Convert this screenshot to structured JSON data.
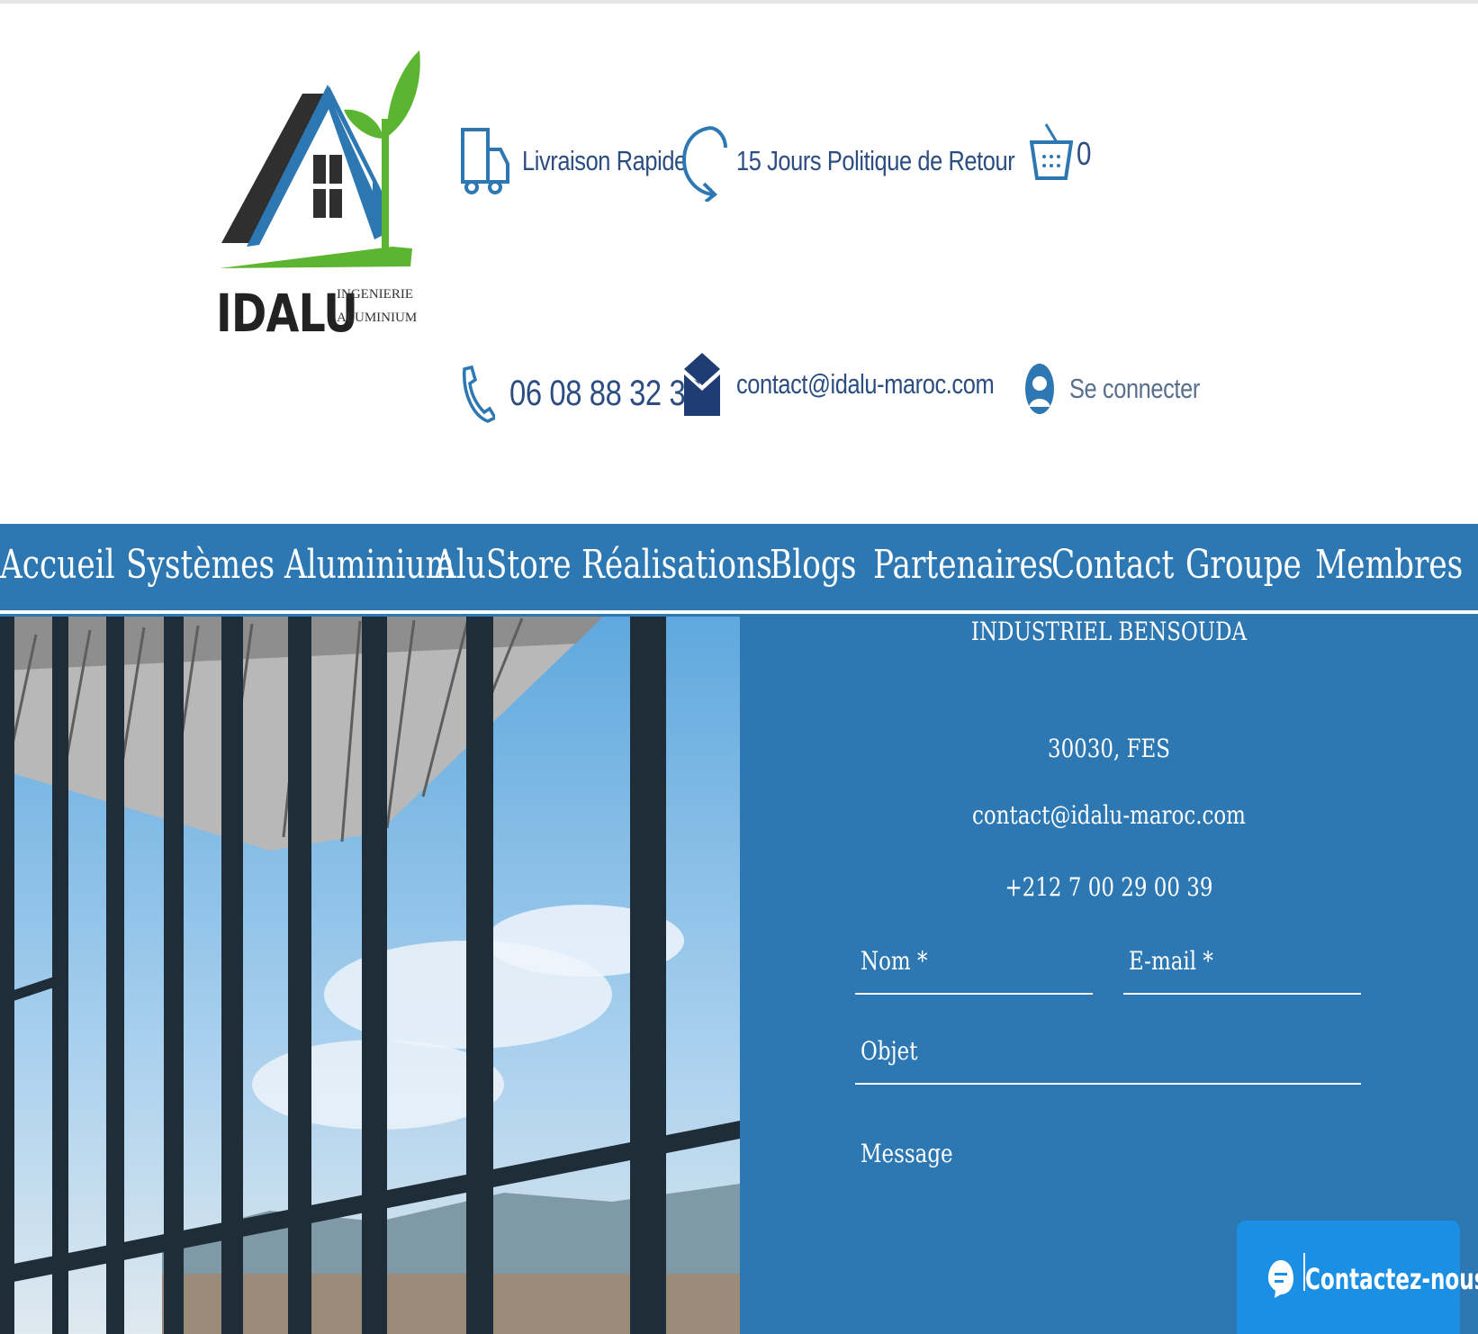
{
  "brand": {
    "name": "IDALU",
    "sub_line1": "INGENIERIE",
    "sub_line2": "ALUMINIUM"
  },
  "header": {
    "delivery": "Livraison Rapide",
    "return_policy": "15 Jours Politique de Retour",
    "cart_count": "0",
    "phone": "06 08 88 32 33",
    "email": "contact@idalu-maroc.com",
    "login": "Se connecter"
  },
  "nav": {
    "items": [
      "Accueil",
      "Systèmes Aluminium",
      "AluStore",
      "Réalisations",
      "Blogs",
      "Partenaires",
      "Contact",
      "Groupe",
      "Membres"
    ]
  },
  "contact": {
    "address_line": "INDUSTRIEL BENSOUDA",
    "city": "30030, FES",
    "email": "contact@idalu-maroc.com",
    "phone": "+212 7 00 29 00 39"
  },
  "form": {
    "name_label": "Nom *",
    "email_label": "E-mail *",
    "subject_label": "Objet",
    "message_label": "Message"
  },
  "chat": {
    "label": "Contactez-nous"
  },
  "colors": {
    "nav_blue": "#2d78b3",
    "header_text": "#2b4d82",
    "chat_button": "#1a8fe3",
    "logo_green": "#5cb531"
  }
}
